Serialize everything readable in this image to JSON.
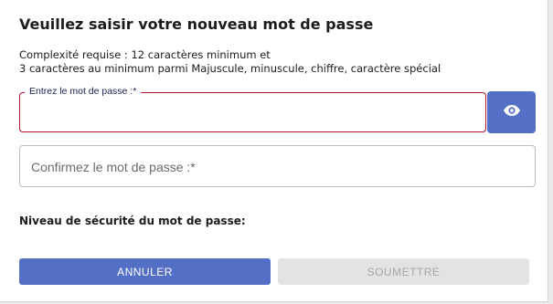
{
  "dialog": {
    "title": "Veuillez saisir votre nouveau mot de passe",
    "requirements": [
      "Complexité requise : 12 caractères minimum et",
      "3 caractères au minimum parmi Majuscule, minuscule, chiffre, caractère spécial"
    ],
    "password_field": {
      "label": "Entrez le mot de passe :*",
      "value": "",
      "state": "error"
    },
    "toggle_visibility_icon": "eye-icon",
    "confirm_field": {
      "placeholder": "Confirmez le mot de passe :*",
      "value": ""
    },
    "security_level_label": "Niveau de sécurité du mot de passe:",
    "buttons": {
      "cancel_label": "ANNULER",
      "submit_label": "SOUMETTRE",
      "submit_disabled": true
    }
  },
  "colors": {
    "primary": "#5470c6",
    "error_border": "#b4152a",
    "disabled_bg": "#e3e3e3",
    "disabled_text": "#a8a8a8"
  }
}
